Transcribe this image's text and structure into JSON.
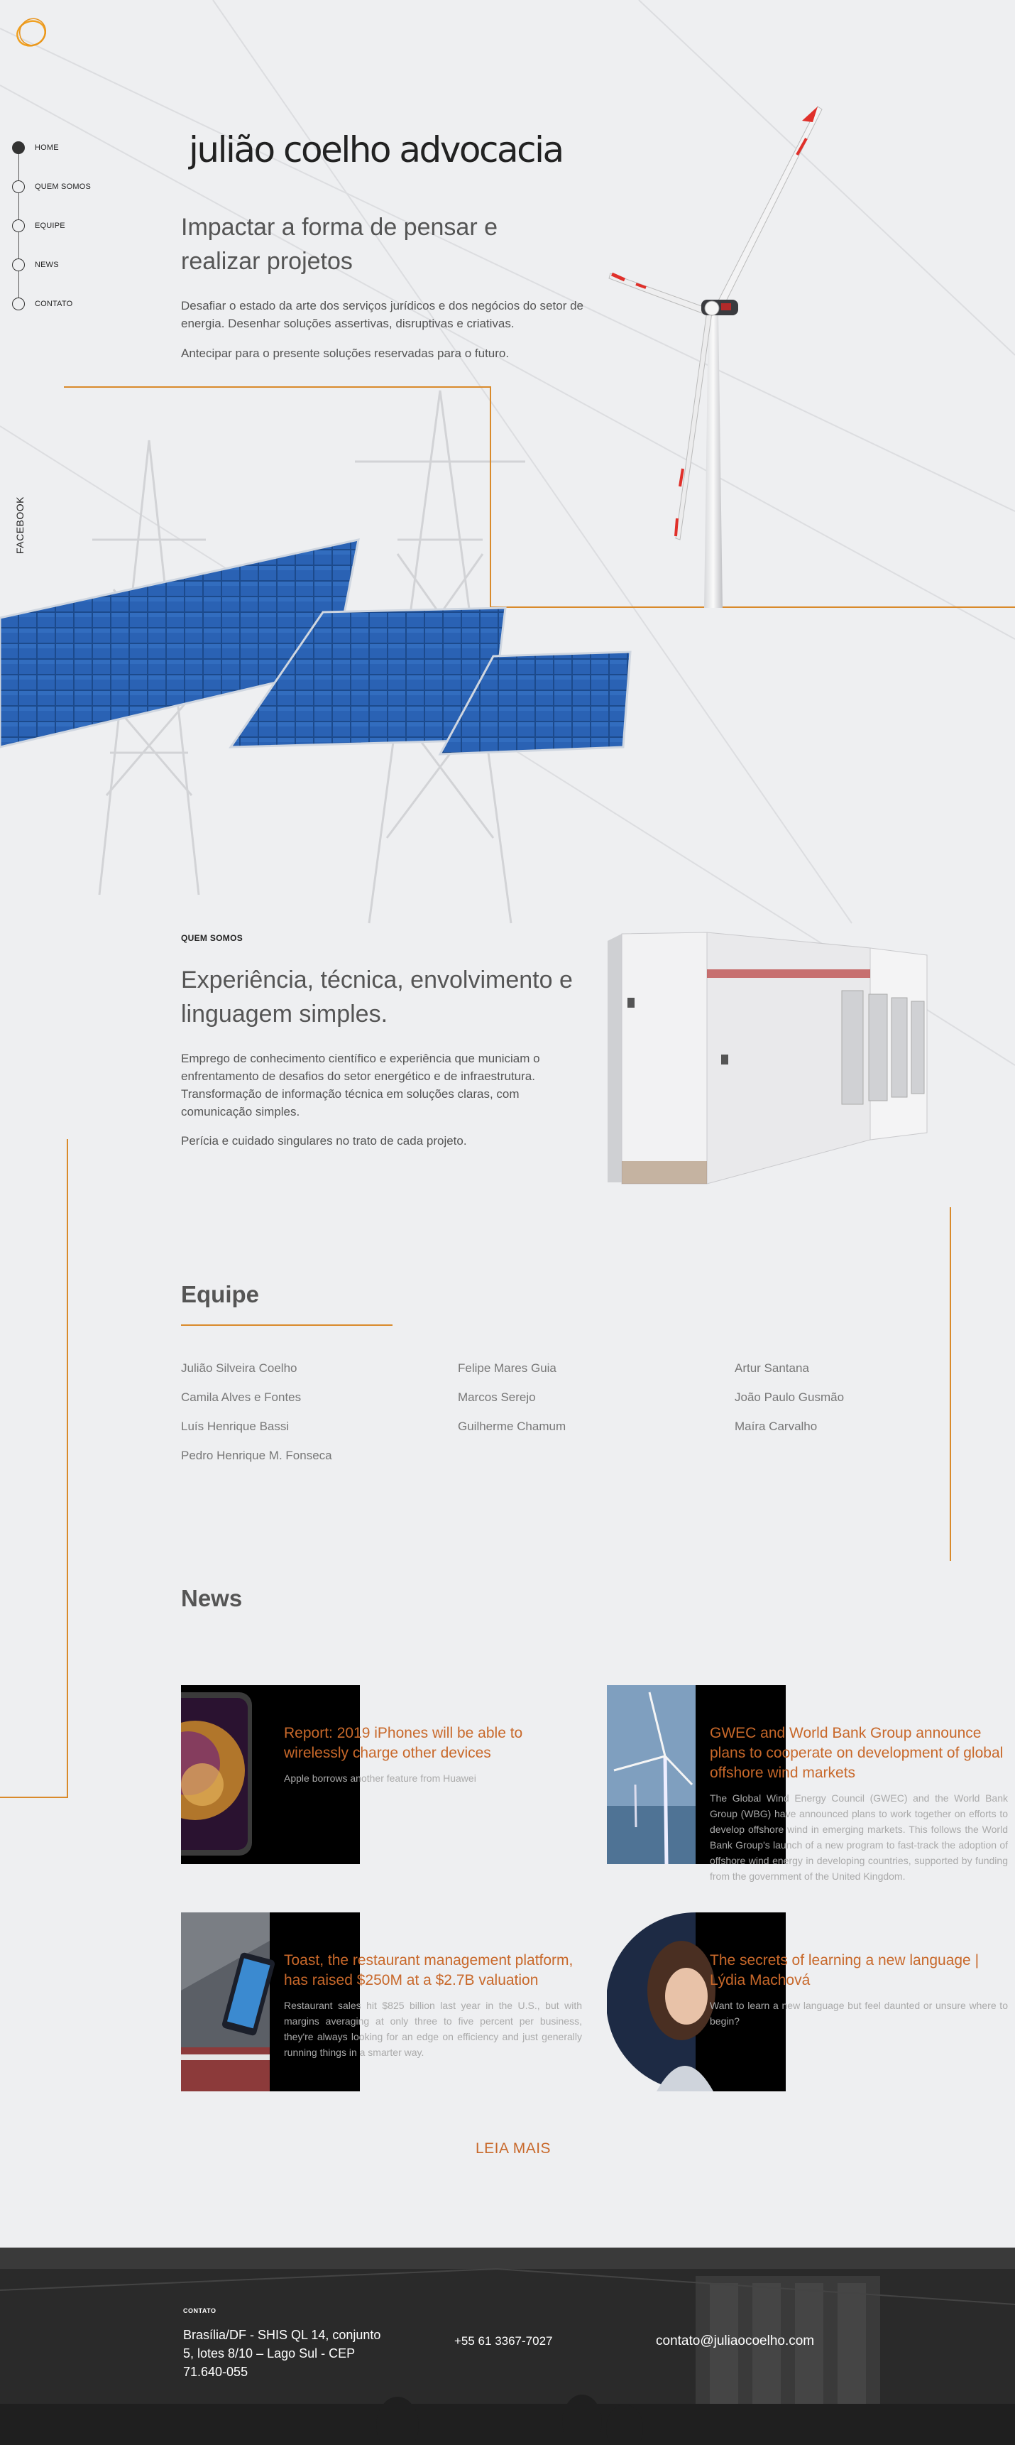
{
  "nav": {
    "items": [
      {
        "label": "HOME"
      },
      {
        "label": "QUEM SOMOS"
      },
      {
        "label": "EQUIPE"
      },
      {
        "label": "NEWS"
      },
      {
        "label": "CONTATO"
      }
    ],
    "social": "FACEBOOK"
  },
  "hero": {
    "brand": "julião coelho advocacia",
    "title": "Impactar a forma de pensar e realizar projetos",
    "paragraph1": "Desafiar o estado da arte dos serviços jurídicos e dos negócios do setor de energia. Desenhar soluções assertivas, disruptivas e criativas.",
    "paragraph2": "Antecipar para o presente soluções reservadas para o futuro."
  },
  "about": {
    "tag": "QUEM SOMOS",
    "title": "Experiência, técnica, envolvimento e linguagem simples.",
    "paragraph1": "Emprego de conhecimento científico e experiência que municiam o enfrentamento de desafios do setor energético e de infraestrutura. Transformação de informação técnica em soluções claras, com comunicação simples.",
    "paragraph2": "Perícia e cuidado singulares no trato de cada projeto."
  },
  "team": {
    "title": "Equipe",
    "columns": [
      [
        "Julião Silveira Coelho",
        "Camila Alves e Fontes",
        "Luís Henrique Bassi",
        "Pedro Henrique M. Fonseca"
      ],
      [
        "Felipe Mares Guia",
        "Marcos Serejo",
        "Guilherme Chamum"
      ],
      [
        "Artur Santana",
        "João Paulo Gusmão",
        "Maíra Carvalho"
      ]
    ]
  },
  "news": {
    "title": "News",
    "cards": [
      {
        "headline": "Report: 2019 iPhones will be able to wirelessly charge other devices",
        "desc": "Apple borrows another feature from Huawei"
      },
      {
        "headline": "GWEC and World Bank Group announce plans to cooperate on development of global offshore wind markets",
        "desc": "The Global Wind Energy Council (GWEC) and the World Bank Group (WBG) have announced plans to work together on efforts to develop offshore wind in emerging markets. This follows the World Bank Group's launch of a new program to fast-track the adoption of offshore wind energy in developing countries, supported by funding from the government of the United Kingdom."
      },
      {
        "headline": "Toast, the restaurant management platform, has raised $250M at a $2.7B valuation",
        "desc": "Restaurant sales hit $825 billion last year in the U.S., but with margins averaging at only three to five percent per business, they're always looking for an edge on efficiency and just generally running things in a smarter way."
      },
      {
        "headline": "The secrets of learning a new language | Lýdia Machová",
        "desc": "Want to learn a new language but feel daunted or unsure where to begin?"
      }
    ],
    "more": "LEIA MAIS"
  },
  "footer": {
    "tag": "CONTATO",
    "address": "Brasília/DF - SHIS QL 14, conjunto 5, lotes 8/10 – Lago Sul - CEP 71.640-055",
    "phone": "+55 61 3367-7027",
    "email": "contato@juliaocoelho.com"
  },
  "colors": {
    "accent": "#d98a2b",
    "news_headline": "#c8682a",
    "background": "#eeeff1",
    "footer": "#2b2b2b"
  }
}
